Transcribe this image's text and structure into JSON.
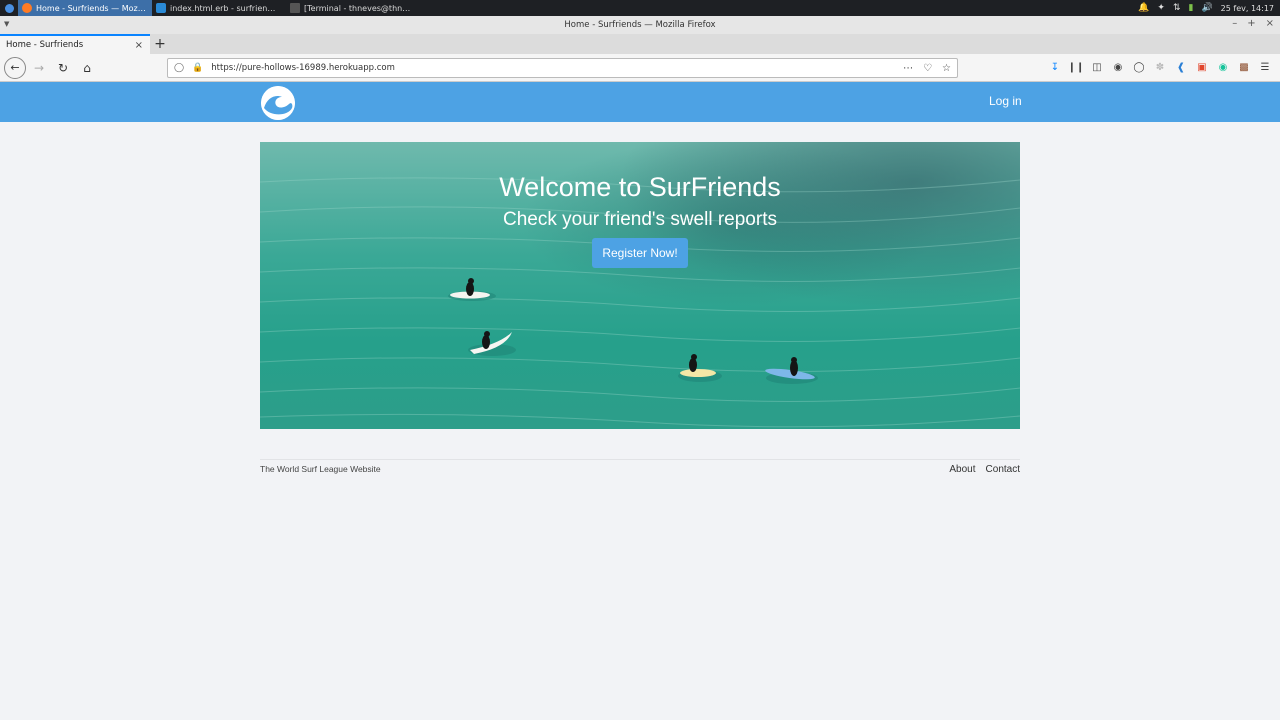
{
  "taskbar": {
    "tasks": [
      {
        "label": "Home - Surfriends — Mozilla..."
      },
      {
        "label": "index.html.erb - surfriends - ..."
      },
      {
        "label": "[Terminal - thneves@thneve..."
      }
    ],
    "clock": "25 fev, 14:17"
  },
  "window": {
    "title": "Home - Surfriends — Mozilla Firefox"
  },
  "browser": {
    "tab_title": "Home - Surfriends",
    "url": "https://pure-hollows-16989.herokuapp.com"
  },
  "site": {
    "login_label": "Log in",
    "hero": {
      "title": "Welcome to SurFriends",
      "subtitle": "Check your friend's swell reports",
      "cta_label": "Register Now!"
    },
    "footer": {
      "text": "The World Surf League Website",
      "links": [
        {
          "label": "About"
        },
        {
          "label": "Contact"
        }
      ]
    }
  },
  "colors": {
    "header_blue": "#4da2e4",
    "page_bg": "#f2f3f6"
  }
}
